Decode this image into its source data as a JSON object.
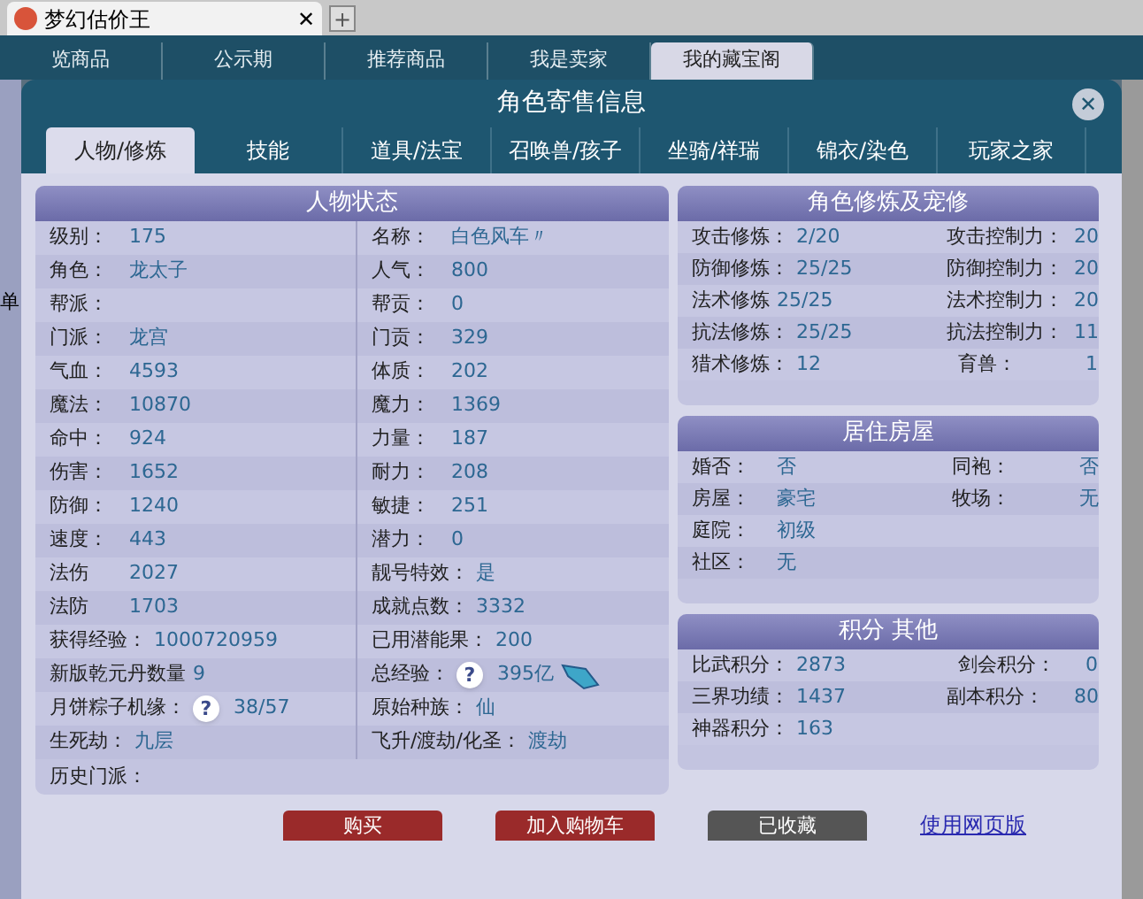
{
  "browser_tab": {
    "title": "梦幻估价王",
    "close_glyph": "✕"
  },
  "new_tab_glyph": "+",
  "site_nav": [
    {
      "label": "览商品",
      "selected": false
    },
    {
      "label": "公示期",
      "selected": false
    },
    {
      "label": "推荐商品",
      "selected": false
    },
    {
      "label": "我是卖家",
      "selected": false
    },
    {
      "label": "我的藏宝阁",
      "selected": true
    }
  ],
  "side_text": "单",
  "dialog": {
    "title": "角色寄售信息",
    "close_glyph": "✕",
    "tabs": [
      {
        "label": "人物/修炼",
        "selected": true
      },
      {
        "label": "技能",
        "selected": false
      },
      {
        "label": "道具/法宝",
        "selected": false
      },
      {
        "label": "召唤兽/孩子",
        "selected": false
      },
      {
        "label": "坐骑/祥瑞",
        "selected": false
      },
      {
        "label": "锦衣/染色",
        "selected": false
      },
      {
        "label": "玩家之家",
        "selected": false
      }
    ]
  },
  "character_status": {
    "title": "人物状态",
    "rows": [
      {
        "left": {
          "label": "级别：",
          "value": "175"
        },
        "right": {
          "label": "名称：",
          "value": "白色风车〃"
        }
      },
      {
        "left": {
          "label": "角色：",
          "value": "龙太子"
        },
        "right": {
          "label": "人气：",
          "value": "800"
        }
      },
      {
        "left": {
          "label": "帮派："
        },
        "right": {
          "label": "帮贡：",
          "value": "0"
        }
      },
      {
        "left": {
          "label": "门派：",
          "value": "龙宫"
        },
        "right": {
          "label": "门贡：",
          "value": "329"
        }
      },
      {
        "left": {
          "label": "气血：",
          "value": "4593"
        },
        "right": {
          "label": "体质：",
          "value": "202"
        }
      },
      {
        "left": {
          "label": "魔法：",
          "value": "10870"
        },
        "right": {
          "label": "魔力：",
          "value": "1369"
        }
      },
      {
        "left": {
          "label": "命中：",
          "value": "924"
        },
        "right": {
          "label": "力量：",
          "value": "187"
        }
      },
      {
        "left": {
          "label": "伤害：",
          "value": "1652"
        },
        "right": {
          "label": "耐力：",
          "value": "208"
        }
      },
      {
        "left": {
          "label": "防御：",
          "value": "1240"
        },
        "right": {
          "label": "敏捷：",
          "value": "251"
        }
      },
      {
        "left": {
          "label": "速度：",
          "value": "443"
        },
        "right": {
          "label": "潜力：",
          "value": "0"
        }
      },
      {
        "left": {
          "label": "法伤",
          "value": "2027"
        },
        "right": {
          "label": "靓号特效：",
          "value": "是"
        }
      },
      {
        "left": {
          "label": "法防",
          "value": "1703"
        },
        "right": {
          "label": "成就点数：",
          "value": "3332"
        }
      },
      {
        "left": {
          "label": "获得经验：",
          "value": "1000720959"
        },
        "right": {
          "label": "已用潜能果：",
          "value": "200"
        }
      },
      {
        "left": {
          "label": "新版乾元丹数量",
          "value": "9"
        },
        "right": {
          "label": "总经验：",
          "help": "?",
          "value": "395亿",
          "gem": true
        }
      },
      {
        "left": {
          "label": "月饼粽子机缘：",
          "help": "?",
          "value": "38/57"
        },
        "right": {
          "label": "原始种族：",
          "value": "仙"
        }
      },
      {
        "left": {
          "label": "生死劫：",
          "value": "九层"
        },
        "right": {
          "label": "飞升/渡劫/化圣：",
          "value": "渡劫"
        }
      }
    ],
    "history": {
      "label": "历史门派："
    }
  },
  "side_sections": [
    {
      "title": "角色修炼及宠修",
      "rows": [
        {
          "left": {
            "label": "攻击修炼：",
            "value": "2/20"
          },
          "right": {
            "label": "攻击控制力：",
            "value": "20"
          }
        },
        {
          "left": {
            "label": "防御修炼：",
            "value": "25/25"
          },
          "right": {
            "label": "防御控制力：",
            "value": "20"
          }
        },
        {
          "left": {
            "label": "法术修炼",
            "value": "25/25"
          },
          "right": {
            "label": "法术控制力：",
            "value": "20"
          }
        },
        {
          "left": {
            "label": "抗法修炼：",
            "value": "25/25"
          },
          "right": {
            "label": "抗法控制力：",
            "value": "11"
          }
        },
        {
          "left": {
            "label": "猎术修炼：",
            "value": "12"
          },
          "right": {
            "label": "育兽：",
            "value": "1"
          }
        }
      ]
    },
    {
      "title": "居住房屋",
      "rows": [
        {
          "left": {
            "label": "婚否：",
            "value": "否"
          },
          "right": {
            "label": "同袍：",
            "value": "否"
          }
        },
        {
          "left": {
            "label": "房屋：",
            "value": "豪宅"
          },
          "right": {
            "label": "牧场：",
            "value": "无"
          }
        },
        {
          "left": {
            "label": "庭院：",
            "value": "初级"
          }
        },
        {
          "left": {
            "label": "社区：",
            "value": "无"
          }
        }
      ]
    },
    {
      "title": "积分 其他",
      "rows": [
        {
          "left": {
            "label": "比武积分：",
            "value": "2873"
          },
          "right": {
            "label": "剑会积分：",
            "value": "0"
          }
        },
        {
          "left": {
            "label": "三界功绩：",
            "value": "1437"
          },
          "right": {
            "label": "副本积分：",
            "value": "80"
          }
        },
        {
          "left": {
            "label": "神器积分：",
            "value": "163"
          }
        }
      ]
    }
  ],
  "actions": [
    {
      "label": "购买",
      "kind": "primary"
    },
    {
      "label": "加入购物车",
      "kind": "primary"
    },
    {
      "label": "已收藏",
      "kind": "muted"
    },
    {
      "label": "使用网页版",
      "kind": "link"
    }
  ]
}
